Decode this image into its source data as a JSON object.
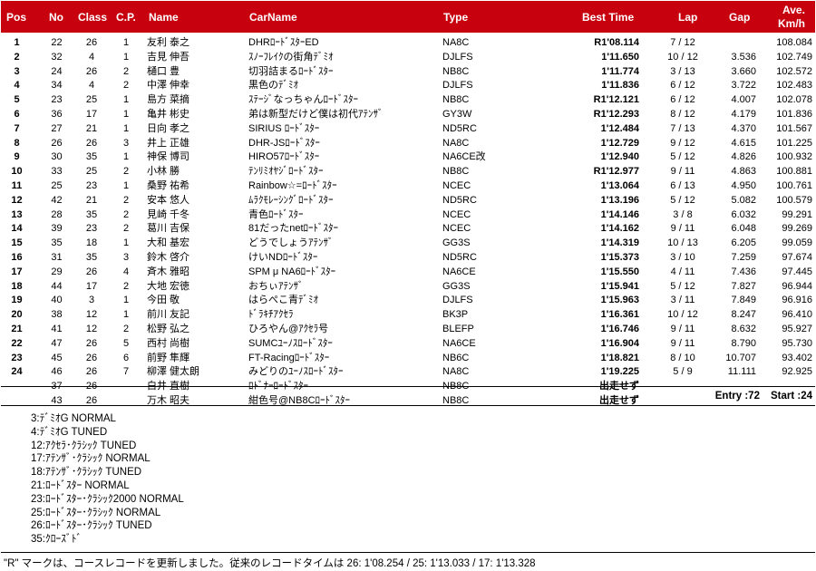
{
  "header": {
    "pos": "Pos",
    "no": "No",
    "class": "Class",
    "cp": "C.P.",
    "name": "Name",
    "car_name": "CarName",
    "type": "Type",
    "best_time": "Best Time",
    "lap": "Lap",
    "gap": "Gap",
    "ave1": "Ave.",
    "ave2": "Km/h"
  },
  "colors": {
    "header_bg": "#c8010f",
    "header_text": "#ffffff"
  },
  "rows": [
    {
      "pos": "1",
      "no": "22",
      "class": "26",
      "cp": "1",
      "name": "友利 泰之",
      "car": "DHRﾛｰﾄﾞｽﾀｰED",
      "type": "NA8C",
      "best": "R1'08.114",
      "lap": "7 / 12",
      "gap": "",
      "ave": "108.084"
    },
    {
      "pos": "2",
      "no": "32",
      "class": "4",
      "cp": "1",
      "name": "吉見 伸吾",
      "car": "ｽﾉｰﾌﾚｲｸの街角ﾃﾞﾐｵ",
      "type": "DJLFS",
      "best": "1'11.650",
      "lap": "10 / 12",
      "gap": "3.536",
      "ave": "102.749"
    },
    {
      "pos": "3",
      "no": "24",
      "class": "26",
      "cp": "2",
      "name": "樋口 豊",
      "car": "切羽詰まるﾛｰﾄﾞｽﾀｰ",
      "type": "NB8C",
      "best": "1'11.774",
      "lap": "3 / 13",
      "gap": "3.660",
      "ave": "102.572"
    },
    {
      "pos": "4",
      "no": "34",
      "class": "4",
      "cp": "2",
      "name": "中澤 伸幸",
      "car": "黒色のﾃﾞﾐｵ",
      "type": "DJLFS",
      "best": "1'11.836",
      "lap": "6 / 12",
      "gap": "3.722",
      "ave": "102.483"
    },
    {
      "pos": "5",
      "no": "23",
      "class": "25",
      "cp": "1",
      "name": "島方 菜摘",
      "car": "ｽﾃｰｼﾞなっちゃんﾛｰﾄﾞｽﾀｰ",
      "type": "NB8C",
      "best": "R1'12.121",
      "lap": "6 / 12",
      "gap": "4.007",
      "ave": "102.078"
    },
    {
      "pos": "6",
      "no": "36",
      "class": "17",
      "cp": "1",
      "name": "亀井 彬史",
      "car": "弟は新型だけど僕は初代ｱﾃﾝｻﾞ",
      "type": "GY3W",
      "best": "R1'12.293",
      "lap": "8 / 12",
      "gap": "4.179",
      "ave": "101.836"
    },
    {
      "pos": "7",
      "no": "27",
      "class": "21",
      "cp": "1",
      "name": "日向 孝之",
      "car": "SIRIUS ﾛｰﾄﾞｽﾀｰ",
      "type": "ND5RC",
      "best": "1'12.484",
      "lap": "7 / 13",
      "gap": "4.370",
      "ave": "101.567"
    },
    {
      "pos": "8",
      "no": "26",
      "class": "26",
      "cp": "3",
      "name": "井上 正雄",
      "car": "DHR-JSﾛｰﾄﾞｽﾀｰ",
      "type": "NA8C",
      "best": "1'12.729",
      "lap": "9 / 12",
      "gap": "4.615",
      "ave": "101.225"
    },
    {
      "pos": "9",
      "no": "30",
      "class": "35",
      "cp": "1",
      "name": "神保 博司",
      "car": "HIRO57ﾛｰﾄﾞｽﾀｰ",
      "type": "NA6CE改",
      "best": "1'12.940",
      "lap": "5 / 12",
      "gap": "4.826",
      "ave": "100.932"
    },
    {
      "pos": "10",
      "no": "33",
      "class": "25",
      "cp": "2",
      "name": "小林 勝",
      "car": "ﾃﾝﾘﾐｵﾔｼﾞﾛｰﾄﾞｽﾀｰ",
      "type": "NB8C",
      "best": "R1'12.977",
      "lap": "9 / 11",
      "gap": "4.863",
      "ave": "100.881"
    },
    {
      "pos": "11",
      "no": "25",
      "class": "23",
      "cp": "1",
      "name": "桑野 祐希",
      "car": "Rainbow☆=ﾛｰﾄﾞｽﾀｰ",
      "type": "NCEC",
      "best": "1'13.064",
      "lap": "6 / 13",
      "gap": "4.950",
      "ave": "100.761"
    },
    {
      "pos": "12",
      "no": "42",
      "class": "21",
      "cp": "2",
      "name": "安本 悠人",
      "car": "ﾑﾗｸﾓﾚｰｼﾝｸﾞﾛｰﾄﾞｽﾀｰ",
      "type": "ND5RC",
      "best": "1'13.196",
      "lap": "5 / 12",
      "gap": "5.082",
      "ave": "100.579"
    },
    {
      "pos": "13",
      "no": "28",
      "class": "35",
      "cp": "2",
      "name": "見崎 千冬",
      "car": "青色ﾛｰﾄﾞｽﾀｰ",
      "type": "NCEC",
      "best": "1'14.146",
      "lap": "3 / 8",
      "gap": "6.032",
      "ave": "99.291"
    },
    {
      "pos": "14",
      "no": "39",
      "class": "23",
      "cp": "2",
      "name": "葛川 吉保",
      "car": "81だったnetﾛｰﾄﾞｽﾀｰ",
      "type": "NCEC",
      "best": "1'14.162",
      "lap": "9 / 11",
      "gap": "6.048",
      "ave": "99.269"
    },
    {
      "pos": "15",
      "no": "35",
      "class": "18",
      "cp": "1",
      "name": "大和 基宏",
      "car": "どうでしょうｱﾃﾝｻﾞ",
      "type": "GG3S",
      "best": "1'14.319",
      "lap": "10 / 13",
      "gap": "6.205",
      "ave": "99.059"
    },
    {
      "pos": "16",
      "no": "31",
      "class": "35",
      "cp": "3",
      "name": "鈴木 啓介",
      "car": "けいNDﾛｰﾄﾞｽﾀｰ",
      "type": "ND5RC",
      "best": "1'15.373",
      "lap": "3 / 10",
      "gap": "7.259",
      "ave": "97.674"
    },
    {
      "pos": "17",
      "no": "29",
      "class": "26",
      "cp": "4",
      "name": "斉木 雅昭",
      "car": "SPM μ NA6ﾛｰﾄﾞｽﾀｰ",
      "type": "NA6CE",
      "best": "1'15.550",
      "lap": "4 / 11",
      "gap": "7.436",
      "ave": "97.445"
    },
    {
      "pos": "18",
      "no": "44",
      "class": "17",
      "cp": "2",
      "name": "大地 宏徳",
      "car": "おちぃｱﾃﾝｻﾞ",
      "type": "GG3S",
      "best": "1'15.941",
      "lap": "5 / 12",
      "gap": "7.827",
      "ave": "96.944"
    },
    {
      "pos": "19",
      "no": "40",
      "class": "3",
      "cp": "1",
      "name": "今田 敬",
      "car": "はらぺこ青ﾃﾞﾐｵ",
      "type": "DJLFS",
      "best": "1'15.963",
      "lap": "3 / 11",
      "gap": "7.849",
      "ave": "96.916"
    },
    {
      "pos": "20",
      "no": "38",
      "class": "12",
      "cp": "1",
      "name": "前川 友記",
      "car": "ﾄﾞﾗｷﾁｱｸｾﾗ",
      "type": "BK3P",
      "best": "1'16.361",
      "lap": "10 / 12",
      "gap": "8.247",
      "ave": "96.410"
    },
    {
      "pos": "21",
      "no": "41",
      "class": "12",
      "cp": "2",
      "name": "松野 弘之",
      "car": "ひろやん@ｱｸｾﾗ号",
      "type": "BLEFP",
      "best": "1'16.746",
      "lap": "9 / 11",
      "gap": "8.632",
      "ave": "95.927"
    },
    {
      "pos": "22",
      "no": "47",
      "class": "26",
      "cp": "5",
      "name": "西村 尚樹",
      "car": "SUMCﾕｰﾉｽﾛｰﾄﾞｽﾀｰ",
      "type": "NA6CE",
      "best": "1'16.904",
      "lap": "9 / 11",
      "gap": "8.790",
      "ave": "95.730"
    },
    {
      "pos": "23",
      "no": "45",
      "class": "26",
      "cp": "6",
      "name": "前野 隼輝",
      "car": "FT-Racingﾛｰﾄﾞｽﾀｰ",
      "type": "NB6C",
      "best": "1'18.821",
      "lap": "8 / 10",
      "gap": "10.707",
      "ave": "93.402"
    },
    {
      "pos": "24",
      "no": "46",
      "class": "26",
      "cp": "7",
      "name": "柳澤 健太朗",
      "car": "みどりのﾕｰﾉｽﾛｰﾄﾞｽﾀｰ",
      "type": "NA8C",
      "best": "1'19.225",
      "lap": "5 / 9",
      "gap": "11.111",
      "ave": "92.925"
    },
    {
      "pos": "",
      "no": "37",
      "class": "26",
      "cp": "",
      "name": "白井 直樹",
      "car": "ﾛﾄﾞﾅｰﾛｰﾄﾞｽﾀｰ",
      "type": "NB8C",
      "best": "出走せず",
      "lap": "",
      "gap": "",
      "ave": ""
    },
    {
      "pos": "",
      "no": "43",
      "class": "26",
      "cp": "",
      "name": "万木 昭夫",
      "car": "紺色号@NB8Cﾛｰﾄﾞｽﾀｰ",
      "type": "NB8C",
      "best": "出走せず",
      "lap": "",
      "gap": "",
      "ave": ""
    }
  ],
  "summary": {
    "entry": "Entry :72",
    "start": "Start :24"
  },
  "legend": [
    "3:ﾃﾞﾐｵG NORMAL",
    "4:ﾃﾞﾐｵG TUNED",
    "12:ｱｸｾﾗ･ｸﾗｼｯｸ TUNED",
    "17:ｱﾃﾝｻﾞ･ｸﾗｼｯｸ NORMAL",
    "18:ｱﾃﾝｻﾞ･ｸﾗｼｯｸ TUNED",
    "21:ﾛｰﾄﾞｽﾀｰ NORMAL",
    "23:ﾛｰﾄﾞｽﾀｰ･ｸﾗｼｯｸ2000 NORMAL",
    "25:ﾛｰﾄﾞｽﾀｰ･ｸﾗｼｯｸ NORMAL",
    "26:ﾛｰﾄﾞｽﾀｰ･ｸﾗｼｯｸ TUNED",
    "35:ｸﾛｰｽﾞﾄﾞ"
  ],
  "footnote": "\"R\" マークは、コースレコードを更新しました。従来のレコードタイムは 26: 1'08.254 / 25: 1'13.033 / 17: 1'13.328"
}
